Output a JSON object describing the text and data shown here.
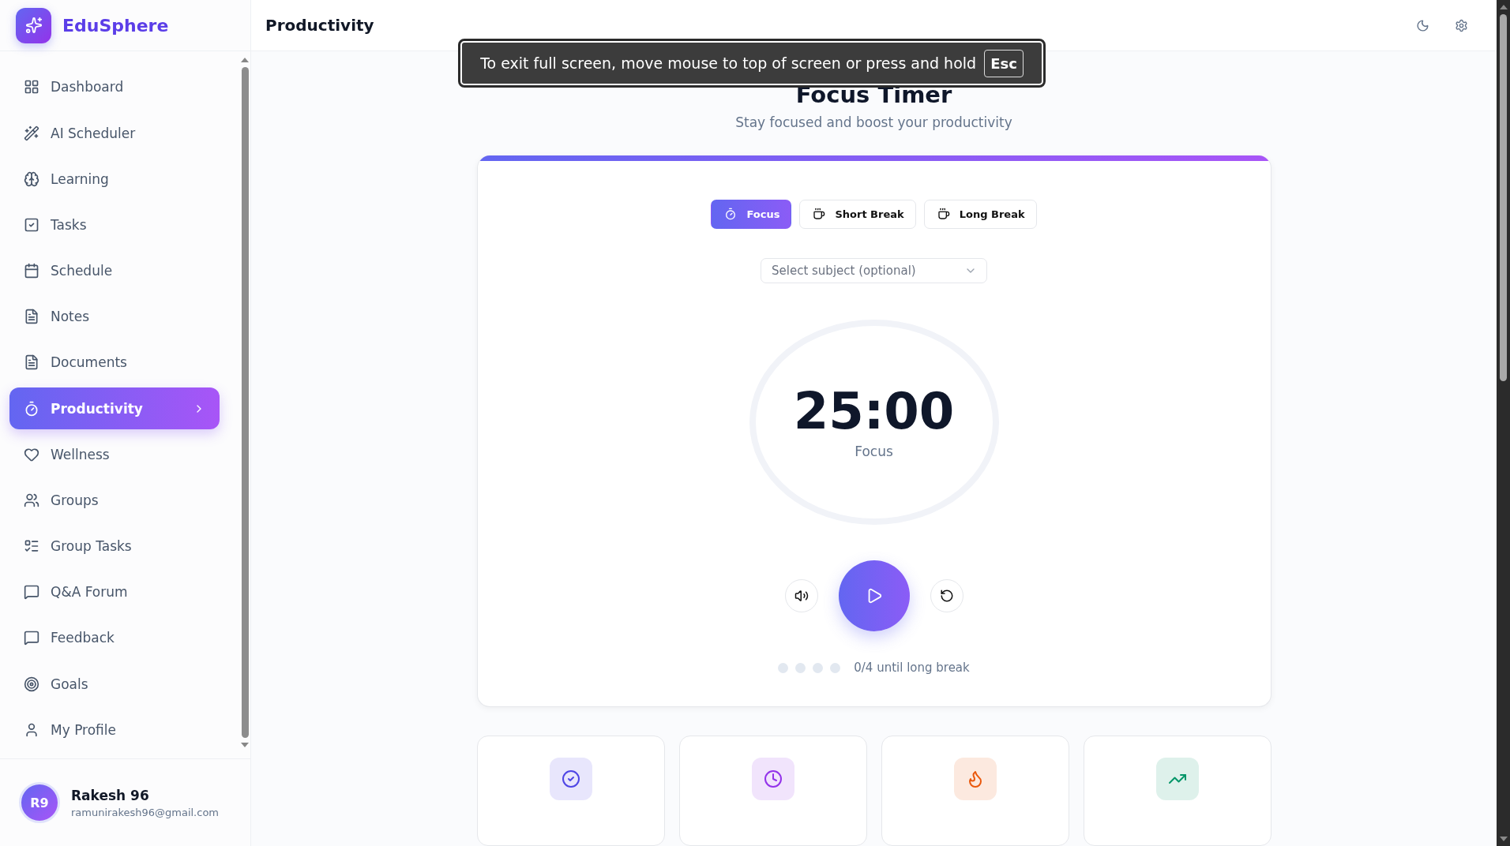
{
  "sidebar": {
    "brand": "EduSphere",
    "items": [
      {
        "label": "Dashboard",
        "selected": false
      },
      {
        "label": "AI Scheduler",
        "selected": false
      },
      {
        "label": "Learning",
        "selected": false
      },
      {
        "label": "Tasks",
        "selected": false
      },
      {
        "label": "Schedule",
        "selected": false
      },
      {
        "label": "Notes",
        "selected": false
      },
      {
        "label": "Documents",
        "selected": false
      },
      {
        "label": "Productivity",
        "selected": true
      },
      {
        "label": "Wellness",
        "selected": false
      },
      {
        "label": "Groups",
        "selected": false
      },
      {
        "label": "Group Tasks",
        "selected": false
      },
      {
        "label": "Q&A Forum",
        "selected": false
      },
      {
        "label": "Feedback",
        "selected": false
      },
      {
        "label": "Goals",
        "selected": false
      },
      {
        "label": "My Profile",
        "selected": false
      }
    ],
    "user": {
      "initials": "R9",
      "name": "Rakesh 96",
      "email": "ramunirakesh96@gmail.com"
    }
  },
  "header": {
    "title": "Productivity"
  },
  "fullscreen_notice": {
    "text": "To exit full screen, move mouse to top of screen or press and hold",
    "key": "Esc"
  },
  "timer": {
    "title": "Focus Timer",
    "subtitle": "Stay focused and boost your productivity",
    "modes": [
      {
        "label": "Focus",
        "kind": "timer",
        "selected": true
      },
      {
        "label": "Short Break",
        "kind": "coffee",
        "selected": false
      },
      {
        "label": "Long Break",
        "kind": "coffee",
        "selected": false
      }
    ],
    "subject_select": {
      "placeholder": "Select subject (optional)"
    },
    "time": "25:00",
    "mode_label": "Focus",
    "sessions": [
      {
        "done": false
      },
      {
        "done": false
      },
      {
        "done": false
      },
      {
        "done": false
      }
    ],
    "sessions_label": "0/4 until long break"
  },
  "stat_cards": [
    {
      "kind": "check",
      "color": "#4f46e5"
    },
    {
      "kind": "clock",
      "color": "#9333ea"
    },
    {
      "kind": "flame",
      "color": "#ea580c"
    },
    {
      "kind": "trend",
      "color": "#059669"
    }
  ]
}
